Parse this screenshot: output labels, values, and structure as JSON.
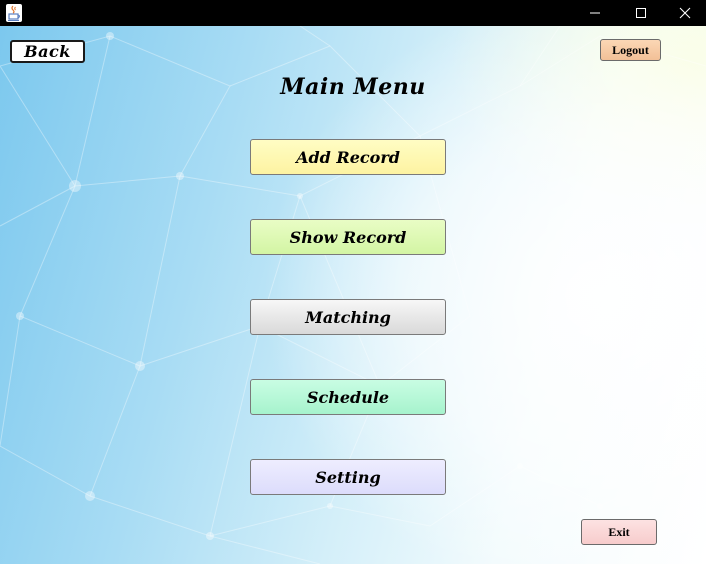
{
  "window": {
    "app_icon": "java-icon",
    "controls": [
      "minimize-icon",
      "maximize-icon",
      "close-icon"
    ]
  },
  "header": {
    "back_label": "Back",
    "logout_label": "Logout"
  },
  "main": {
    "title": "Main Menu",
    "menu_items": [
      {
        "label": "Add Record",
        "color": "#fef9b4"
      },
      {
        "label": "Show Record",
        "color": "#dffab4"
      },
      {
        "label": "Matching",
        "color": "#e6e6e6"
      },
      {
        "label": "Schedule",
        "color": "#b6f9d8"
      },
      {
        "label": "Setting",
        "color": "#e4e3fd"
      }
    ]
  },
  "footer": {
    "exit_label": "Exit"
  },
  "colors": {
    "titlebar": "#000000",
    "logout_bg": "#f6c9a3",
    "exit_bg": "#fad6d6",
    "background_accent": "#8ccff0"
  }
}
